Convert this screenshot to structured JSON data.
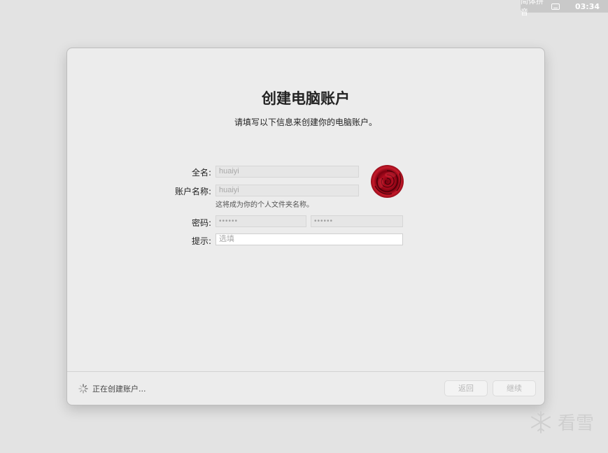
{
  "menubar": {
    "input_method": "简体拼音",
    "time": "03:34",
    "keyboard_icon": "keyboard-icon"
  },
  "dialog": {
    "title": "创建电脑账户",
    "subtitle": "请填写以下信息来创建你的电脑账户。",
    "form": {
      "full_name_label": "全名:",
      "full_name_value": "huaiyi",
      "account_name_label": "账户名称:",
      "account_name_value": "huaiyi",
      "account_name_note": "这将成为你的个人文件夹名称。",
      "password_label": "密码:",
      "password_value": "••••••",
      "verify_value": "••••••",
      "hint_label": "提示:",
      "hint_placeholder": "选填"
    },
    "avatar_icon": "rose-avatar",
    "status_text": "正在创建账户...",
    "back_label": "返回",
    "continue_label": "继续"
  },
  "watermark": {
    "text": "看雪",
    "icon": "snowflake-icon"
  },
  "colors": {
    "background": "#e3e3e3",
    "window": "#ececec",
    "avatar_red": "#b20d20"
  }
}
